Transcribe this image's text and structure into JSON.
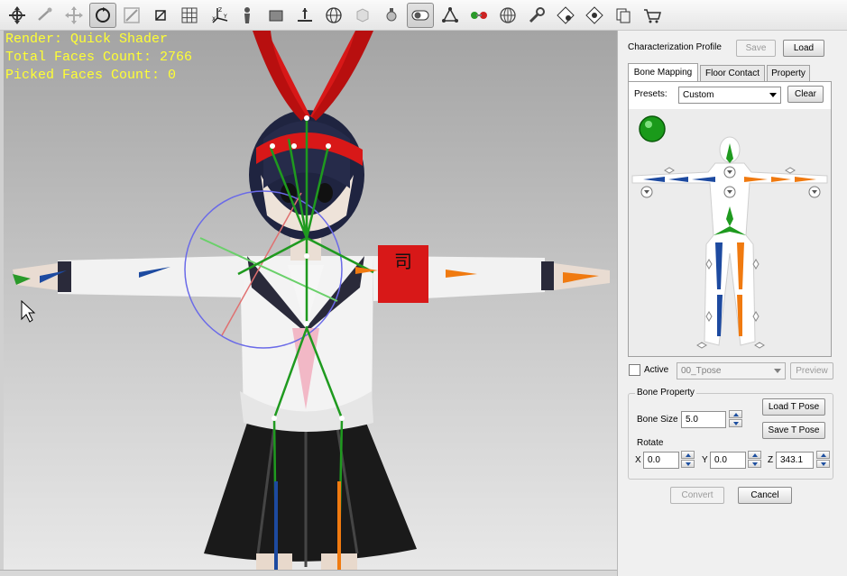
{
  "toolbar": {
    "icons": [
      "move-icon",
      "bone-pick-icon",
      "pan-icon",
      "rotate-icon",
      "scale-icon",
      "select-box-icon",
      "grid-icon",
      "axis-icon",
      "figure-icon",
      "rectangle-icon",
      "floor-icon",
      "sphere-grid-icon",
      "cube-icon",
      "light-bulb-icon",
      "toggle-view-icon",
      "bone-group-icon",
      "color-balls-icon",
      "globe-icon",
      "wrench-icon",
      "settings-plugin-icon",
      "settings-plugin-2-icon",
      "export-icon",
      "cart-icon"
    ]
  },
  "viewport": {
    "render_label": "Render: Quick Shader",
    "total_faces_label": "Total Faces Count: 2766",
    "picked_faces_label": "Picked Faces Count: 0",
    "armband_char": "司"
  },
  "panel": {
    "profile_label": "Characterization Profile",
    "save_button": "Save",
    "load_button": "Load",
    "tabs": [
      {
        "label": "Bone Mapping",
        "selected": true
      },
      {
        "label": "Floor Contact",
        "selected": false
      },
      {
        "label": "Property",
        "selected": false
      }
    ],
    "presets_label": "Presets:",
    "preset_value": "Custom",
    "clear_button": "Clear",
    "active_label": "Active",
    "pose_value": "00_Tpose",
    "preview_button": "Preview",
    "bone_property_title": "Bone Property",
    "bone_size_label": "Bone Size",
    "bone_size_value": "5.0",
    "load_tpose_button": "Load T Pose",
    "save_tpose_button": "Save T Pose",
    "rotate_label": "Rotate",
    "x_label": "X",
    "x_value": "0.0",
    "y_label": "Y",
    "y_value": "0.0",
    "z_label": "Z",
    "z_value": "343.1",
    "convert_button": "Convert",
    "cancel_button": "Cancel"
  },
  "colors": {
    "hud_text": "#ffff33",
    "bone_green": "#1f9a1f",
    "left_limb_blue": "#1d4aa0",
    "right_limb_orange": "#f07a10",
    "ribbon_red": "#d81818"
  }
}
